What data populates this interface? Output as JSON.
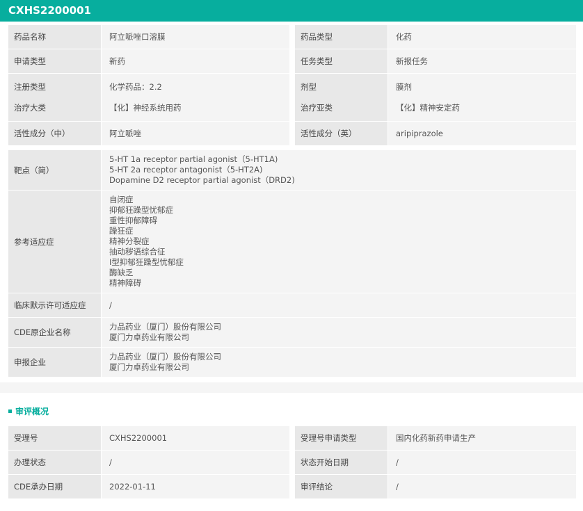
{
  "header": {
    "title": "CXHS2200001"
  },
  "basic": [
    {
      "label": "药品名称",
      "value": "阿立哌唑口溶膜"
    },
    {
      "label": "药品类型",
      "value": "化药"
    },
    {
      "label": "申请类型",
      "value": "新药"
    },
    {
      "label": "任务类型",
      "value": "新报任务"
    },
    {
      "label": "注册类型",
      "value": "化学药品：2.2",
      "label2": "治疗大类",
      "value2": "【化】神经系统用药"
    },
    {
      "label": "剂型",
      "value": "膜剂",
      "label2": "治疗亚类",
      "value2": "【化】精神安定药"
    },
    {
      "label": "活性成分（中）",
      "value": "阿立哌唑"
    },
    {
      "label": "活性成分（英）",
      "value": "aripiprazole"
    }
  ],
  "detail": [
    {
      "label": "靶点（简）",
      "lines": [
        "5-HT 1a receptor partial agonist（5-HT1A)",
        "5-HT 2a receptor antagonist（5-HT2A)",
        "Dopamine D2 receptor partial agonist（DRD2)"
      ]
    },
    {
      "label": "参考适应症",
      "lines": [
        "自闭症",
        "抑郁狂躁型忧郁症",
        "重性抑郁障碍",
        "躁狂症",
        "精神分裂症",
        "抽动秽语综合征",
        "I型抑郁狂躁型忧郁症",
        "酶缺乏",
        "精神障碍"
      ]
    },
    {
      "label": "临床默示许可适应症",
      "lines": [
        "/"
      ]
    },
    {
      "label": "CDE原企业名称",
      "lines": [
        "力品药业（厦门）股份有限公司",
        "厦门力卓药业有限公司"
      ]
    },
    {
      "label": "申报企业",
      "lines": [
        "力品药业（厦门）股份有限公司",
        "厦门力卓药业有限公司"
      ]
    }
  ],
  "review": {
    "title": "审评概况",
    "rows": [
      {
        "label": "受理号",
        "value": "CXHS2200001"
      },
      {
        "label": "受理号申请类型",
        "value": "国内化药新药申请生产"
      },
      {
        "label": "办理状态",
        "value": "/"
      },
      {
        "label": "状态开始日期",
        "value": "/"
      },
      {
        "label": "CDE承办日期",
        "value": "2022-01-11"
      },
      {
        "label": "审评结论",
        "value": "/"
      }
    ]
  },
  "colors": {
    "accent": "#07ae9e"
  }
}
